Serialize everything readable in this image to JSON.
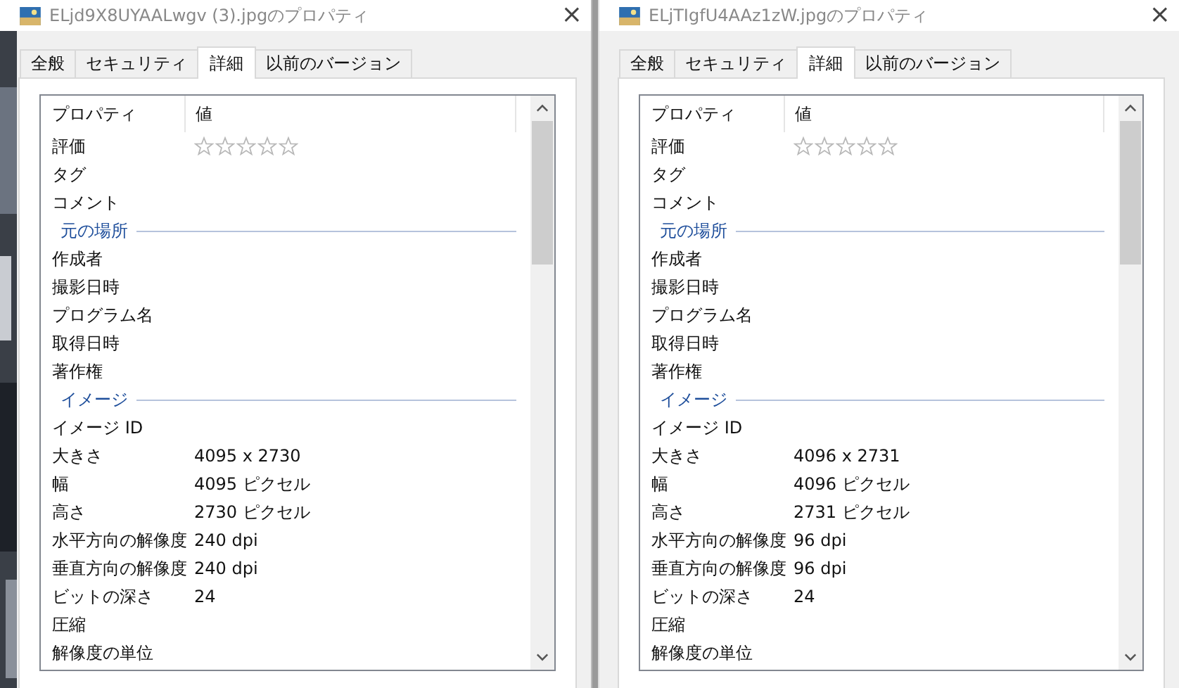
{
  "windows": [
    {
      "title": "ELjd9X8UYAALwgv (3).jpgのプロパティ",
      "close": "×",
      "tabs": [
        {
          "label": "全般",
          "selected": false
        },
        {
          "label": "セキュリティ",
          "selected": false
        },
        {
          "label": "詳細",
          "selected": true
        },
        {
          "label": "以前のバージョン",
          "selected": false
        }
      ],
      "columns": [
        "プロパティ",
        "値"
      ],
      "rows": [
        {
          "kind": "rating",
          "name": "評価",
          "stars": 0
        },
        {
          "kind": "row",
          "name": "タグ"
        },
        {
          "kind": "row",
          "name": "コメント"
        },
        {
          "kind": "section",
          "name": "元の場所"
        },
        {
          "kind": "row",
          "name": "作成者"
        },
        {
          "kind": "row",
          "name": "撮影日時"
        },
        {
          "kind": "row",
          "name": "プログラム名"
        },
        {
          "kind": "row",
          "name": "取得日時"
        },
        {
          "kind": "row",
          "name": "著作権"
        },
        {
          "kind": "section",
          "name": "イメージ"
        },
        {
          "kind": "row",
          "name": "イメージ ID"
        },
        {
          "kind": "row",
          "name": "大きさ",
          "value": "4095 x 2730"
        },
        {
          "kind": "row",
          "name": "幅",
          "value": "4095 ピクセル"
        },
        {
          "kind": "row",
          "name": "高さ",
          "value": "2730 ピクセル"
        },
        {
          "kind": "row",
          "name": "水平方向の解像度",
          "value": "240 dpi"
        },
        {
          "kind": "row",
          "name": "垂直方向の解像度",
          "value": "240 dpi"
        },
        {
          "kind": "row",
          "name": "ビットの深さ",
          "value": "24"
        },
        {
          "kind": "row",
          "name": "圧縮"
        },
        {
          "kind": "row",
          "name": "解像度の単位"
        }
      ]
    },
    {
      "title": "ELjTIgfU4AAz1zW.jpgのプロパティ",
      "close": "×",
      "tabs": [
        {
          "label": "全般",
          "selected": false
        },
        {
          "label": "セキュリティ",
          "selected": false
        },
        {
          "label": "詳細",
          "selected": true
        },
        {
          "label": "以前のバージョン",
          "selected": false
        }
      ],
      "columns": [
        "プロパティ",
        "値"
      ],
      "rows": [
        {
          "kind": "rating",
          "name": "評価",
          "stars": 0
        },
        {
          "kind": "row",
          "name": "タグ"
        },
        {
          "kind": "row",
          "name": "コメント"
        },
        {
          "kind": "section",
          "name": "元の場所"
        },
        {
          "kind": "row",
          "name": "作成者"
        },
        {
          "kind": "row",
          "name": "撮影日時"
        },
        {
          "kind": "row",
          "name": "プログラム名"
        },
        {
          "kind": "row",
          "name": "取得日時"
        },
        {
          "kind": "row",
          "name": "著作権"
        },
        {
          "kind": "section",
          "name": "イメージ"
        },
        {
          "kind": "row",
          "name": "イメージ ID"
        },
        {
          "kind": "row",
          "name": "大きさ",
          "value": "4096 x 2731"
        },
        {
          "kind": "row",
          "name": "幅",
          "value": "4096 ピクセル"
        },
        {
          "kind": "row",
          "name": "高さ",
          "value": "2731 ピクセル"
        },
        {
          "kind": "row",
          "name": "水平方向の解像度",
          "value": "96 dpi"
        },
        {
          "kind": "row",
          "name": "垂直方向の解像度",
          "value": "96 dpi"
        },
        {
          "kind": "row",
          "name": "ビットの深さ",
          "value": "24"
        },
        {
          "kind": "row",
          "name": "圧縮"
        },
        {
          "kind": "row",
          "name": "解像度の単位"
        }
      ]
    }
  ]
}
